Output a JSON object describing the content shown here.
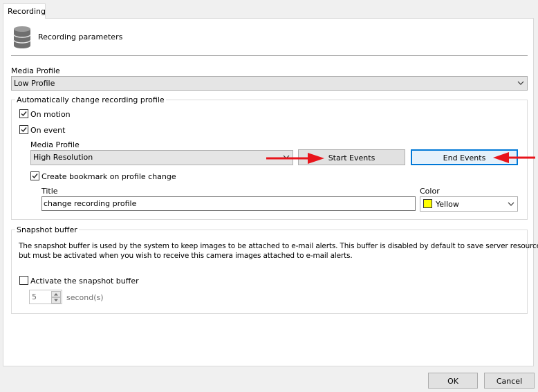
{
  "tab": {
    "label": "Recording"
  },
  "header": {
    "title": "Recording parameters",
    "icon": "database-icon"
  },
  "media_profile": {
    "label": "Media Profile",
    "value": "Low Profile"
  },
  "auto_change": {
    "group_label": "Automatically change recording profile",
    "on_motion": {
      "label": "On motion",
      "checked": true
    },
    "on_event": {
      "label": "On event",
      "checked": true
    },
    "profile_label": "Media Profile",
    "profile_value": "High Resolution",
    "start_events_label": "Start Events",
    "end_events_label": "End Events",
    "bookmark": {
      "label": "Create bookmark on profile change",
      "checked": true
    },
    "title_label": "Title",
    "title_value": "change recording profile",
    "color_label": "Color",
    "color_value": "Yellow",
    "color_swatch": "#ffff00"
  },
  "snapshot": {
    "group_label": "Snapshot buffer",
    "description_line1": "The snapshot buffer is used by the system to keep images to be attached to e-mail alerts. This buffer is disabled by default to save server resources,",
    "description_line2": "but must be activated when you wish to receive this camera images attached to e-mail alerts.",
    "activate": {
      "label": "Activate the snapshot buffer",
      "checked": false
    },
    "seconds_value": "5",
    "seconds_unit": "second(s)"
  },
  "footer": {
    "ok_label": "OK",
    "cancel_label": "Cancel"
  },
  "colors": {
    "annotation_arrow": "#e8141b",
    "focus_border": "#0078d7"
  }
}
